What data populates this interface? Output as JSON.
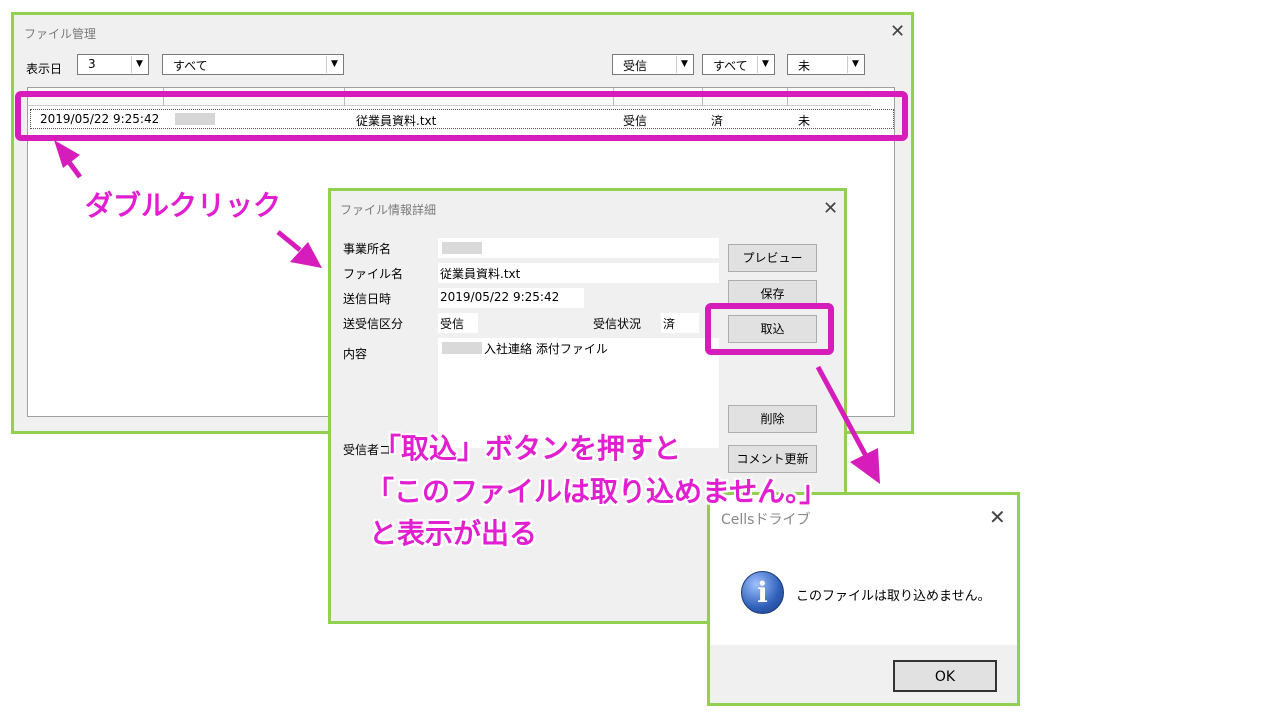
{
  "file_window": {
    "title": "ファイル管理",
    "filter_label": "表示日",
    "days_value": "3",
    "all_value_1": "すべて",
    "direction_value": "受信",
    "all_value_2": "すべて",
    "status_value": "未",
    "row": {
      "datetime": "2019/05/22 9:25:42",
      "file": "従業員資料.txt",
      "direction": "受信",
      "state": "済",
      "status": "未"
    }
  },
  "detail_window": {
    "title": "ファイル情報詳細",
    "office_label": "事業所名",
    "filename_label": "ファイル名",
    "filename_value": "従業員資料.txt",
    "sent_label": "送信日時",
    "sent_value": "2019/05/22 9:25:42",
    "type_label": "送受信区分",
    "type_value": "受信",
    "status_label": "受信状況",
    "status_value": "済",
    "content_label": "内容",
    "content_value": "入社連絡 添付ファイル",
    "receiver_label": "受信者コ",
    "buttons": {
      "preview": "プレビュー",
      "save": "保存",
      "import": "取込",
      "delete": "削除",
      "comment": "コメント更新"
    }
  },
  "message_box": {
    "title": "Cellsドライブ",
    "message": "このファイルは取り込めません。",
    "ok": "OK"
  },
  "annotations": {
    "double_click": "ダブルクリック",
    "line1": "「取込」ボタンを押すと",
    "line2": "「このファイルは取り込めません。」",
    "line3": "と表示が出る"
  },
  "colors": {
    "frame": "#92d050",
    "highlight": "#d61cba",
    "annotation": "#e11fd0",
    "info_icon": "#2f5fb8"
  }
}
